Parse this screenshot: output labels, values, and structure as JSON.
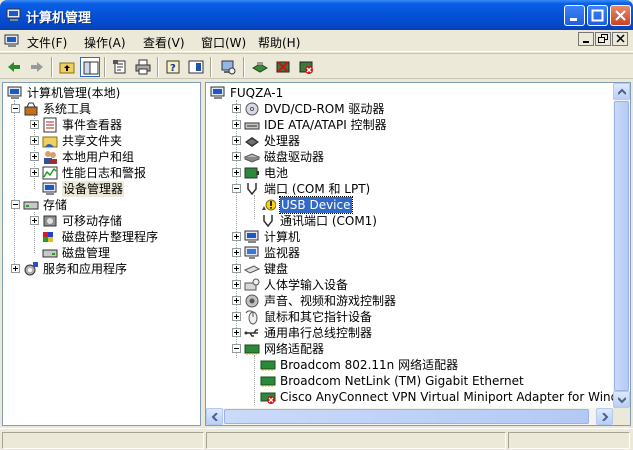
{
  "window": {
    "title": "计算机管理"
  },
  "menu": [
    {
      "label": "文件(F)"
    },
    {
      "label": "操作(A)"
    },
    {
      "label": "查看(V)"
    },
    {
      "label": "窗口(W)"
    },
    {
      "label": "帮助(H)"
    }
  ],
  "toolbar": [
    "back-icon",
    "forward-icon",
    "up-folder-icon",
    "show-tree-icon",
    "properties-icon",
    "print-icon",
    "help-icon",
    "console-icon",
    "scan-hardware-icon",
    "update-driver-icon",
    "disable-device-icon",
    "uninstall-device-icon"
  ],
  "left_tree": {
    "root": "计算机管理(本地)",
    "system_tools": "系统工具",
    "event_viewer": "事件查看器",
    "shared_folders": "共享文件夹",
    "local_users": "本地用户和组",
    "perf_logs": "性能日志和警报",
    "device_manager": "设备管理器",
    "storage": "存储",
    "removable_storage": "可移动存储",
    "defrag": "磁盘碎片整理程序",
    "disk_mgmt": "磁盘管理",
    "services_apps": "服务和应用程序"
  },
  "right_tree": {
    "root": "FUQZA-1",
    "dvd": "DVD/CD-ROM 驱动器",
    "ide": "IDE ATA/ATAPI 控制器",
    "cpu": "处理器",
    "disk": "磁盘驱动器",
    "battery": "电池",
    "ports": "端口 (COM 和 LPT)",
    "usb_device": "USB Device",
    "com1": "通讯端口 (COM1)",
    "computer": "计算机",
    "monitor": "监视器",
    "keyboard": "键盘",
    "hid": "人体学输入设备",
    "sound": "声音、视频和游戏控制器",
    "mouse": "鼠标和其它指针设备",
    "usb_ctrl": "通用串行总线控制器",
    "network": "网络适配器",
    "broadcom_wifi": "Broadcom 802.11n 网络适配器",
    "broadcom_eth": "Broadcom NetLink (TM) Gigabit Ethernet",
    "cisco": "Cisco AnyConnect VPN Virtual Miniport Adapter for Windows"
  },
  "colors": {
    "title_blue": "#0451d8",
    "selection": "#316ac5",
    "warning": "#f2d21a"
  }
}
